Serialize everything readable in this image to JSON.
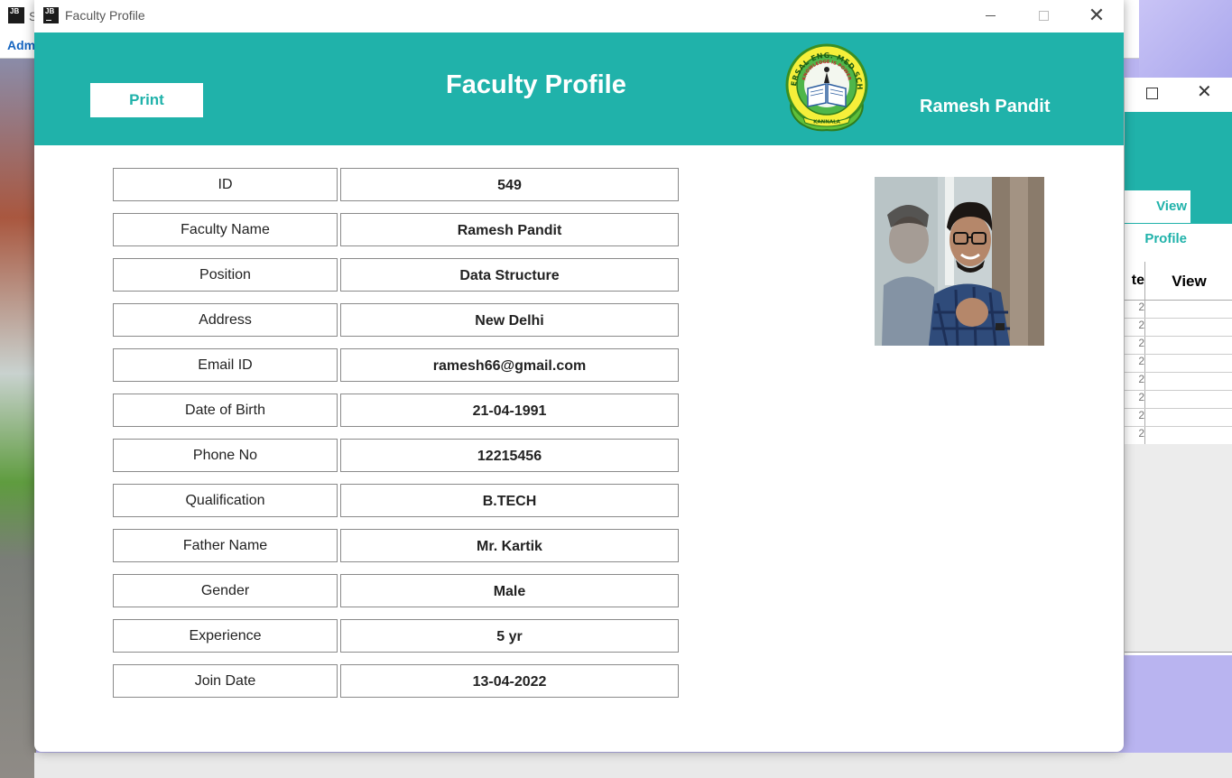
{
  "background": {
    "window1": {
      "icon_text": "JB",
      "menu_label": "Adm",
      "title_fragment": "S"
    },
    "window2": {
      "button_label": "View Profile",
      "col_fragment": "te",
      "col_view": "View",
      "row_digits": [
        "2",
        "2",
        "2",
        "2",
        "2",
        "2",
        "2",
        "2"
      ]
    }
  },
  "window": {
    "title": "Faculty Profile",
    "icon_text": "JB"
  },
  "header": {
    "print_label": "Print",
    "title": "Faculty Profile",
    "user_name": "Ramesh Pandit",
    "logo": {
      "arc_text": "UNIVERSAL ENG. MED SCHOOL",
      "motto": "KNOWLEDGE IS POWER",
      "place": "KANNALA"
    }
  },
  "profile": [
    {
      "label": "ID",
      "value": "549"
    },
    {
      "label": "Faculty Name",
      "value": "Ramesh Pandit"
    },
    {
      "label": "Position",
      "value": "Data Structure"
    },
    {
      "label": "Address",
      "value": "New Delhi"
    },
    {
      "label": "Email ID",
      "value": "ramesh66@gmail.com"
    },
    {
      "label": "Date of Birth",
      "value": "21-04-1991"
    },
    {
      "label": "Phone No",
      "value": "12215456"
    },
    {
      "label": "Qualification",
      "value": "B.TECH"
    },
    {
      "label": "Father Name",
      "value": "Mr. Kartik"
    },
    {
      "label": "Gender",
      "value": "Male"
    },
    {
      "label": "Experience",
      "value": "5 yr"
    },
    {
      "label": "Join Date",
      "value": "13-04-2022"
    }
  ],
  "colors": {
    "accent": "#20b2aa",
    "header_text": "#ffffff"
  },
  "icons": [
    "minimize-icon",
    "maximize-icon",
    "close-icon",
    "app-icon",
    "school-logo-icon"
  ]
}
